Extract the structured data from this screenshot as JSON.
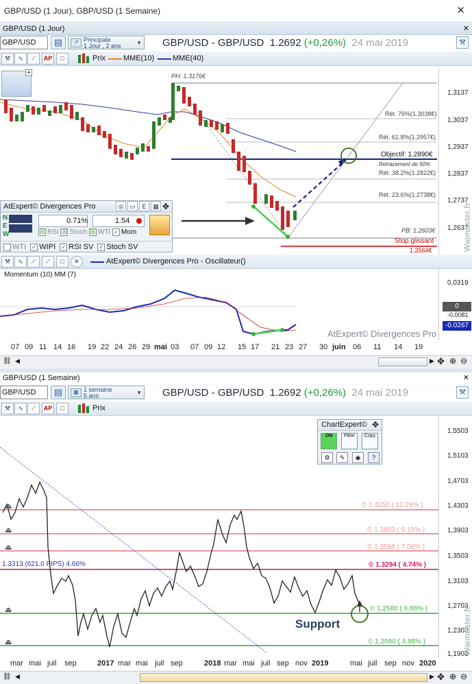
{
  "window": {
    "title": "GBP/USD (1 Jour), GBP/USD (1 Semaine)"
  },
  "top": {
    "pane_title": "GBP/USD (1 Jour)",
    "symbol": "GBP/USD",
    "period_main": "Principale",
    "period_sub": "1 Jour , 2 ans",
    "instrument": "GBP/USD - GBP/USD",
    "price": "1.2692",
    "change": "(+0,26%)",
    "date": "24 mai 2019",
    "legend_prix": "Prix",
    "legend_mme10": "MME(10)",
    "legend_mme40": "MME(40)",
    "y_labels": [
      "1,3137",
      "1,3037",
      "1,2937",
      "1,2837",
      "1,2737",
      "1,2637"
    ],
    "ph": "PH: 1.3176€",
    "pb": "PB: 1.2603€",
    "ret76": "Rét. 76%(1.3038€)",
    "ret618": "Rét. 61.8%(1.2957€)",
    "objectif": "Objectif: 1.2890€",
    "retr50": "Retracement de 50%",
    "ret382": "Rét. 38.2%(1.2822€)",
    "ret236": "Rét. 23.6%(1.2738€)",
    "stop": "Stop glissant",
    "stop_val": "1.2564€",
    "watermark": "Waimaster.fr"
  },
  "atexpert": {
    "title": "AtExpert© Divergences Pro",
    "pct": "0.71%",
    "ratio": "1.54",
    "mom": "Mom",
    "rsi": "RSI",
    "stoch": "Stoch",
    "wti": "WTI",
    "wti2": "WTI",
    "wipi": "WIPI",
    "rsisv": "RSI SV",
    "stochsv": "Stoch SV",
    "n": "N",
    "e": "E",
    "w": "W"
  },
  "osc": {
    "legend": "AtExpert© Divergences Pro - Oscillateur()",
    "label": "Momentum (10) MM (7)",
    "y_top": "0,0319",
    "zero": "0",
    "y_mid": "-0,0081",
    "current": "-0.0267",
    "wm": "AtExpert© Divergences Pro"
  },
  "x_daily": [
    "07",
    "09",
    "11",
    "14",
    "16",
    "19",
    "22",
    "24",
    "26",
    "29",
    "mai",
    "03",
    "07",
    "09",
    "12",
    "15",
    "17",
    "21",
    "23",
    "27",
    "30",
    "juin",
    "06",
    "11",
    "14",
    "19"
  ],
  "bottom": {
    "pane_title": "GBP/USD (1 Semaine)",
    "symbol": "GBP/USD",
    "period_main": "1 semaine",
    "period_sub": "5 ans",
    "instrument": "GBP/USD - GBP/USD",
    "price": "1.2692",
    "change": "(+0,26%)",
    "date": "24 mai 2019",
    "legend_prix": "Prix",
    "y_labels": [
      "1,5503",
      "1,5103",
      "1,4703",
      "1,4303",
      "1,3903",
      "1,3503",
      "1,3103",
      "1,2703",
      "1,2303",
      "1,1903"
    ],
    "lvl1": "© 1.4250 ( 12.28% )",
    "lvl2": "© 1.3853 ( 9.15% )",
    "lvl3": "© 1.3588 ( 7.06% )",
    "lvl4": "© 1.3294 ( 4.74% )",
    "lvl5": "© 1.2580 ( 0.88% )",
    "lvl6": "© 1.2060 ( 4.98% )",
    "left_note": "1.3313   (621.0 PIPS)   4.66%",
    "support": "Support",
    "watermark": "Waimaster.fr"
  },
  "chartexpert": {
    "title": "ChartExpert©",
    "on": "ON",
    "filtre": "Filtre",
    "copy": "Copy"
  },
  "x_weekly": [
    "mar",
    "mai",
    "juil",
    "sep",
    "2017",
    "mar",
    "mai",
    "juil",
    "sep",
    "2018",
    "mar",
    "mai",
    "juil",
    "sep",
    "nov",
    "2019",
    "mai",
    "juil",
    "sep",
    "nov",
    "2020"
  ]
}
